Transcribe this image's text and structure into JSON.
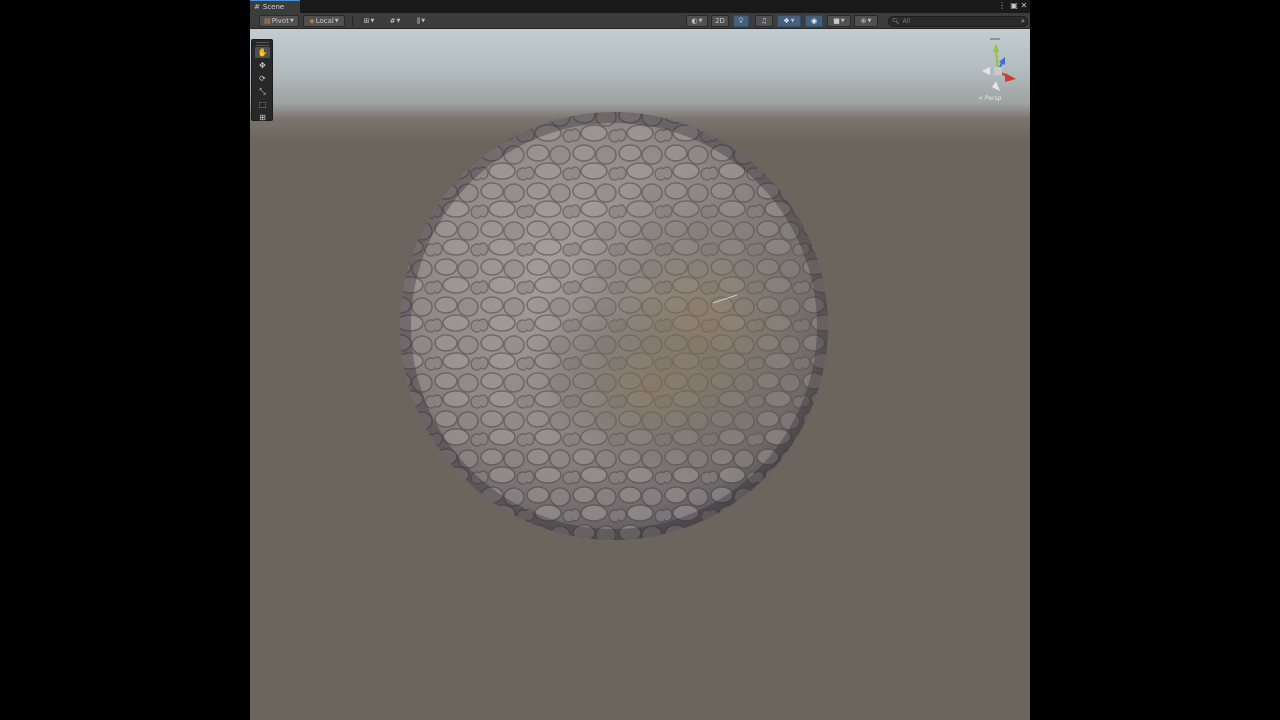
{
  "window": {
    "tab_label": "Scene",
    "tab_icon": "scene-icon",
    "controls": [
      "more-icon",
      "maximize-icon",
      "close-icon"
    ]
  },
  "toolbar": {
    "pivot_label": "Pivot",
    "local_label": "Local",
    "mode_2d_label": "2D",
    "search": {
      "value": "",
      "placeholder": "All"
    }
  },
  "tools": [
    {
      "name": "hand-tool",
      "icon": "hand-icon",
      "glyph": "✋",
      "active": true
    },
    {
      "name": "move-tool",
      "icon": "move-icon",
      "glyph": "✥",
      "active": false
    },
    {
      "name": "rotate-tool",
      "icon": "rotate-icon",
      "glyph": "⟳",
      "active": false
    },
    {
      "name": "scale-tool",
      "icon": "scale-icon",
      "glyph": "⤡",
      "active": false
    },
    {
      "name": "rect-tool",
      "icon": "rect-icon",
      "glyph": "⬚",
      "active": false
    },
    {
      "name": "transform-tool",
      "icon": "transform-icon",
      "glyph": "⊞",
      "active": false
    }
  ],
  "gizmo": {
    "axes": {
      "x": "#d23b2e",
      "y": "#8fc63e",
      "z": "#3a6fd8"
    },
    "projection_label": "< Persp"
  },
  "colors": {
    "accent": "#4a90d9",
    "ground": "#6b655d",
    "sky": "#c3cdd1"
  }
}
